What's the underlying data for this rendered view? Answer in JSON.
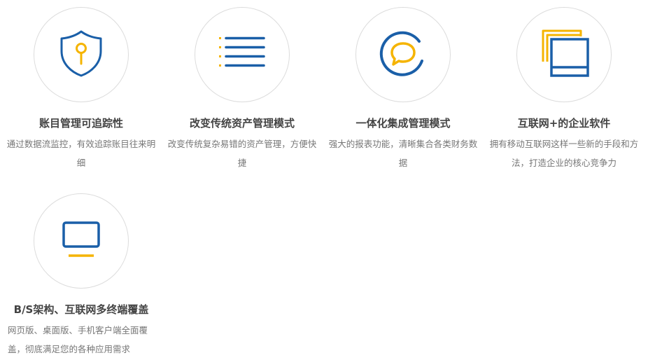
{
  "features": [
    {
      "icon": "shield-keyhole-icon",
      "title": "账目管理可追踪性",
      "desc": "通过数据流监控，有效追踪账目往来明细"
    },
    {
      "icon": "list-icon",
      "title": "改变传统资产管理模式",
      "desc": "改变传统复杂易错的资产管理，方便快捷"
    },
    {
      "icon": "chat-bubble-icon",
      "title": "一体化集成管理模式",
      "desc": "强大的报表功能，清晰集合各类财务数据"
    },
    {
      "icon": "windows-stack-icon",
      "title": "互联网+的企业软件",
      "desc": "拥有移动互联网这样一些新的手段和方法，打造企业的核心竞争力"
    },
    {
      "icon": "monitor-icon",
      "title": "B/S架构、互联网多终端覆盖",
      "desc": "网页版、桌面版、手机客户端全面覆盖，彻底满足您的各种应用需求"
    }
  ],
  "colors": {
    "blue": "#1a5fa8",
    "yellow": "#f5b400"
  }
}
